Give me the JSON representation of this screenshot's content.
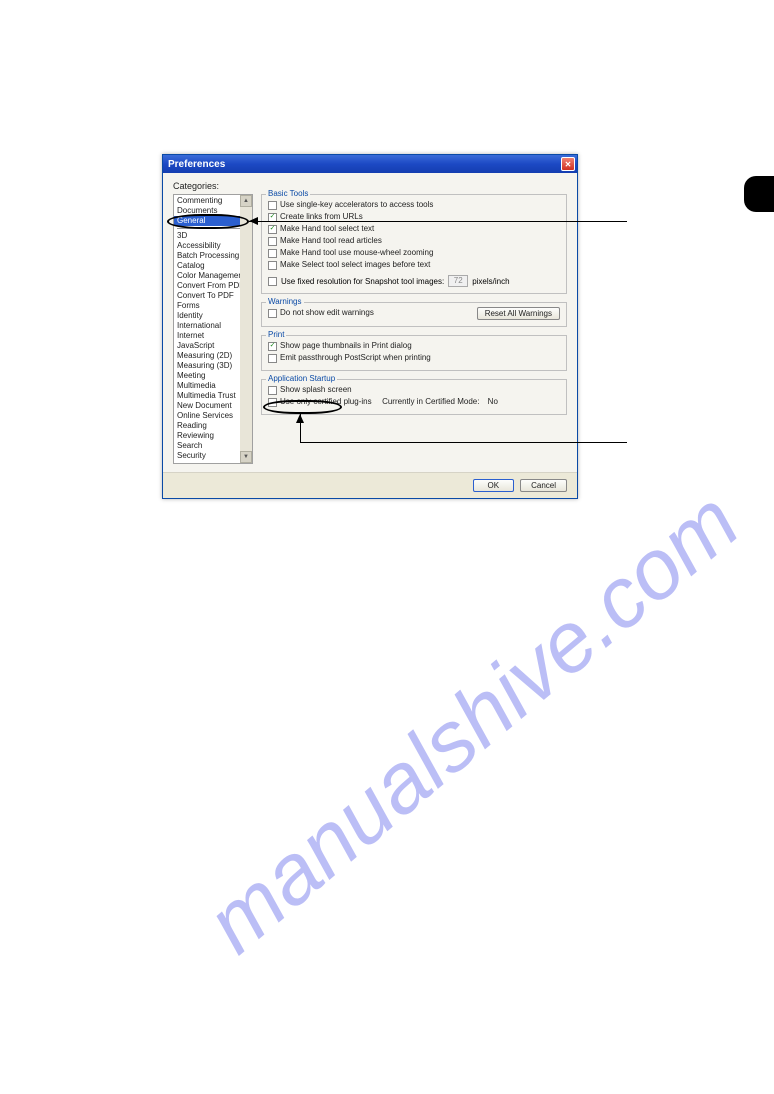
{
  "watermark": "manualshive.com",
  "dialog": {
    "title": "Preferences",
    "categories_label": "Categories:",
    "ok_label": "OK",
    "cancel_label": "Cancel"
  },
  "sidebar": {
    "items_top": [
      "Commenting",
      "Documents"
    ],
    "selected": "General",
    "items_bottom": [
      "3D",
      "Accessibility",
      "Batch Processing",
      "Catalog",
      "Color Management",
      "Convert From PDF",
      "Convert To PDF",
      "Forms",
      "Identity",
      "International",
      "Internet",
      "JavaScript",
      "Measuring (2D)",
      "Measuring (3D)",
      "Meeting",
      "Multimedia",
      "Multimedia Trust",
      "New Document",
      "Online Services",
      "Reading",
      "Reviewing",
      "Search",
      "Security"
    ]
  },
  "basic_tools": {
    "legend": "Basic Tools",
    "options": [
      {
        "label": "Use single-key accelerators to access tools",
        "checked": false
      },
      {
        "label": "Create links from URLs",
        "checked": true
      },
      {
        "label": "Make Hand tool select text",
        "checked": true
      },
      {
        "label": "Make Hand tool read articles",
        "checked": false
      },
      {
        "label": "Make Hand tool use mouse-wheel zooming",
        "checked": false
      },
      {
        "label": "Make Select tool select images before text",
        "checked": false
      }
    ],
    "snapshot": {
      "label": "Use fixed resolution for Snapshot tool images:",
      "value": "72",
      "unit": "pixels/inch",
      "checked": false
    }
  },
  "warnings": {
    "legend": "Warnings",
    "option": {
      "label": "Do not show edit warnings",
      "checked": false
    },
    "reset_label": "Reset All Warnings"
  },
  "print": {
    "legend": "Print",
    "options": [
      {
        "label": "Show page thumbnails in Print dialog",
        "checked": true
      },
      {
        "label": "Emit passthrough PostScript when printing",
        "checked": false
      }
    ]
  },
  "startup": {
    "legend": "Application Startup",
    "options": [
      {
        "label": "Show splash screen",
        "checked": false
      },
      {
        "label": "Use only certified plug-ins",
        "checked": false
      }
    ],
    "mode_label": "Currently in Certified Mode:",
    "mode_value": "No"
  }
}
